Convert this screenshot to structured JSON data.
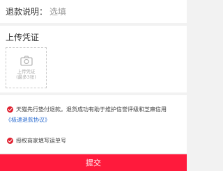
{
  "reason": {
    "label": "退款说明：",
    "value": "选填"
  },
  "upload": {
    "title": "上传凭证",
    "icon": "camera-icon",
    "hint_line1": "上传凭证",
    "hint_line2": "(最多3张)"
  },
  "agreements": {
    "item1_text": "天猫先行垫付退款。退货成功有助于维护信誉评级和芝麻信用",
    "item1_link": "《极速退款协议》",
    "item2_text": "授权商家填写运单号"
  },
  "submit": {
    "label": "提交"
  },
  "colors": {
    "accent": "#ff1a3c",
    "check": "#e0202f",
    "link": "#2f6fd1"
  }
}
